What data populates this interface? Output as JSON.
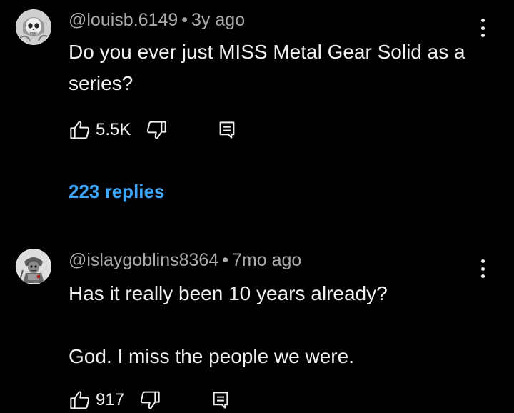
{
  "comments": [
    {
      "author": "@louisb.6149",
      "time": "3y ago",
      "paragraphs": [
        "Do you ever just MISS Metal Gear Solid as a series?"
      ],
      "likes": "5.5K",
      "replies": "223 replies",
      "avatar_icon": "skull-avatar-icon"
    },
    {
      "author": "@islaygoblins8364",
      "time": "7mo ago",
      "paragraphs": [
        "Has it really been 10 years already?",
        "God. I miss the people we were."
      ],
      "likes": "917",
      "avatar_icon": "goblin-avatar-icon"
    }
  ],
  "separator": "•",
  "colors": {
    "background": "#000000",
    "text": "#f1f1f1",
    "meta": "#aaaaaa",
    "link": "#3ea6ff"
  }
}
